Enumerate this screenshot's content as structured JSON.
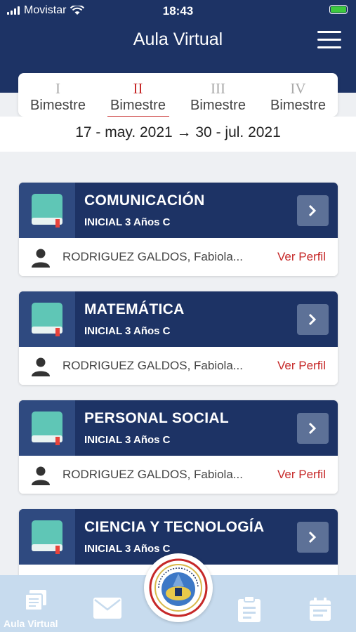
{
  "status_bar": {
    "carrier": "Movistar",
    "time": "18:43"
  },
  "header": {
    "title": "Aula Virtual"
  },
  "terms": [
    {
      "roman": "I",
      "label": "Bimestre",
      "active": false
    },
    {
      "roman": "II",
      "label": "Bimestre",
      "active": true
    },
    {
      "roman": "III",
      "label": "Bimestre",
      "active": false
    },
    {
      "roman": "IV",
      "label": "Bimestre",
      "active": false
    }
  ],
  "date_range": "17 - may. 2021 → 30 - jul. 2021",
  "courses": [
    {
      "name": "COMUNICACIÓN",
      "level": "INICIAL 3 Años C",
      "teacher": "RODRIGUEZ GALDOS, Fabiola...",
      "profile_link": "Ver Perfil"
    },
    {
      "name": "MATEMÁTICA",
      "level": "INICIAL 3 Años C",
      "teacher": "RODRIGUEZ GALDOS, Fabiola...",
      "profile_link": "Ver Perfil"
    },
    {
      "name": "PERSONAL SOCIAL",
      "level": "INICIAL 3 Años C",
      "teacher": "RODRIGUEZ GALDOS, Fabiola...",
      "profile_link": "Ver Perfil"
    },
    {
      "name": "CIENCIA Y TECNOLOGÍA",
      "level": "INICIAL 3 Años C",
      "teacher": "",
      "profile_link": ""
    }
  ],
  "bottom_nav": {
    "active_label": "Aula Virtual",
    "items": [
      "book-icon",
      "mail-icon",
      "school-emblem",
      "clipboard-icon",
      "calendar-icon"
    ]
  },
  "colors": {
    "primary": "#1d3365",
    "accent": "#c62828",
    "book": "#5fc6b6",
    "nav_bg": "#c7dbee"
  }
}
